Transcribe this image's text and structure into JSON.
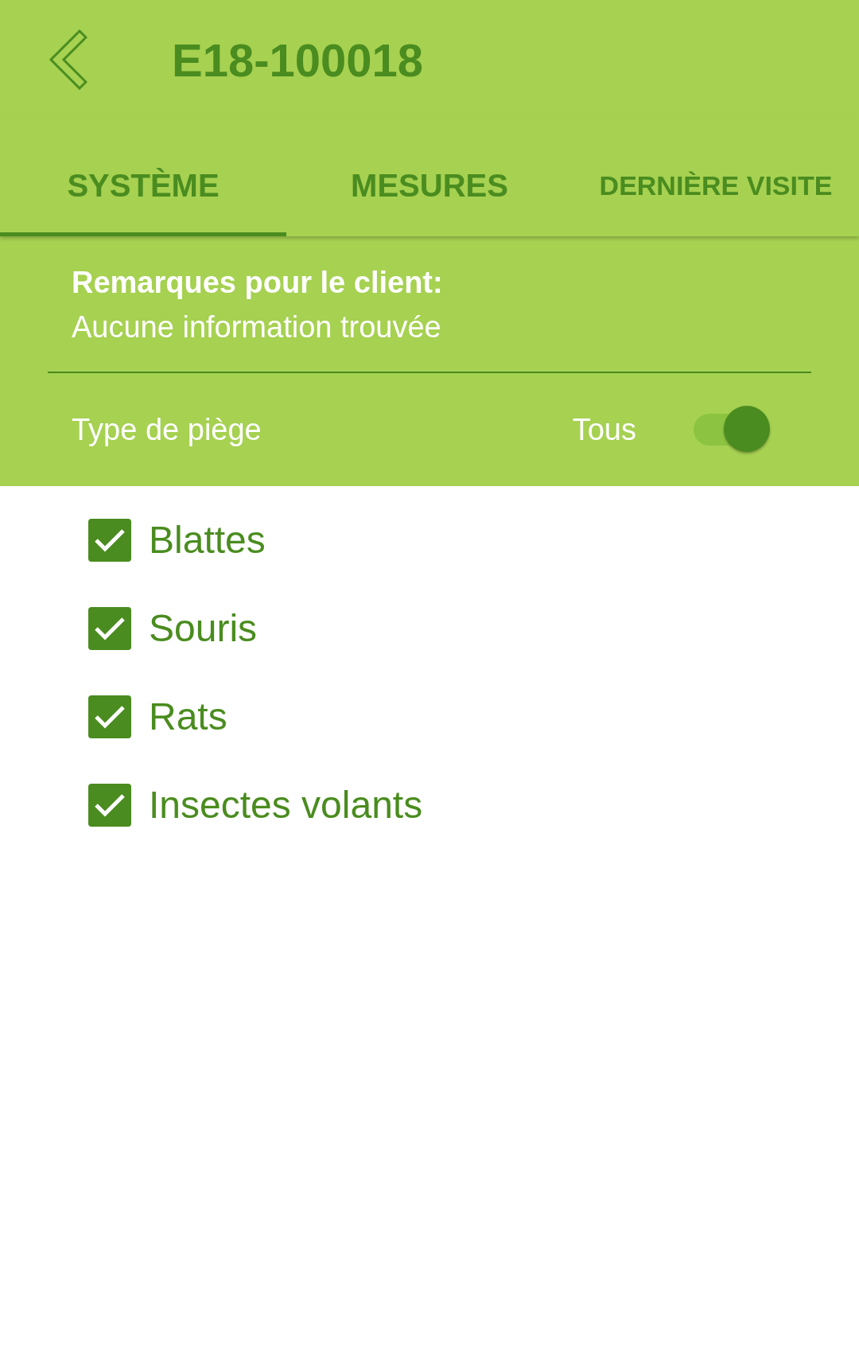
{
  "header": {
    "title": "E18-100018"
  },
  "tabs": [
    {
      "label": "SYSTÈME",
      "selected": true
    },
    {
      "label": "MESURES",
      "selected": false
    },
    {
      "label": "DERNIÈRE VISITE",
      "selected": false
    }
  ],
  "remarks": {
    "label": "Remarques pour le client:",
    "value": "Aucune information trouvée"
  },
  "trap_filter": {
    "label": "Type de piège",
    "toggle_label": "Tous",
    "on": true
  },
  "trap_types": [
    {
      "label": "Blattes",
      "checked": true
    },
    {
      "label": "Souris",
      "checked": true
    },
    {
      "label": "Rats",
      "checked": true
    },
    {
      "label": "Insectes volants",
      "checked": true
    }
  ]
}
